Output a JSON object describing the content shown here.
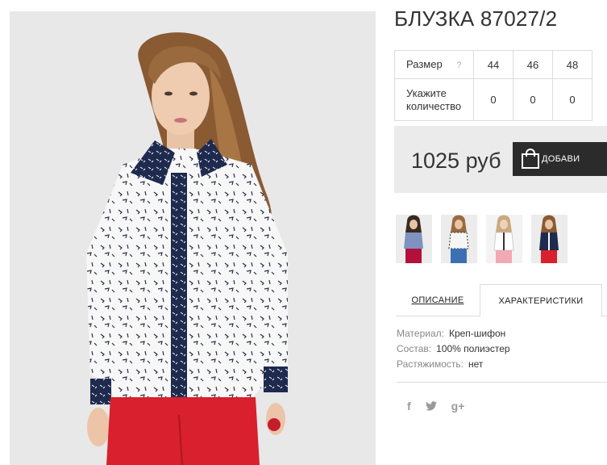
{
  "product": {
    "title": "БЛУЗКА 87027/2",
    "main_image": "product-photo"
  },
  "sizes": {
    "size_label": "Размер",
    "help_mark": "?",
    "qty_label_line1": "Укажите",
    "qty_label_line2": "количество",
    "values": [
      "44",
      "46",
      "48"
    ],
    "quantities": [
      "0",
      "0",
      "0"
    ]
  },
  "purchase": {
    "price": "1025 руб",
    "add_button_label": "ДОБАВИ",
    "add_button_icon": "shopping-bag-icon"
  },
  "thumbnails": [
    {
      "label": "thumbnail-1"
    },
    {
      "label": "thumbnail-2"
    },
    {
      "label": "thumbnail-3"
    },
    {
      "label": "thumbnail-4"
    }
  ],
  "tabs": {
    "description": "ОПИСАНИЕ",
    "characteristics": "ХАРАКТЕРИСТИКИ",
    "active": "characteristics"
  },
  "specs": [
    {
      "key": "Материал:",
      "value": "Креп-шифон"
    },
    {
      "key": "Состав:",
      "value": "100% полиэстер"
    },
    {
      "key": "Растяжимость:",
      "value": "нет"
    }
  ],
  "social": {
    "facebook": "f",
    "twitter": "twitter-icon",
    "googleplus": "g+"
  },
  "colors": {
    "accent_dark": "#2b2b2b",
    "price_bg": "#ebebeb",
    "navy": "#1e2a4e",
    "red": "#d8202e"
  }
}
